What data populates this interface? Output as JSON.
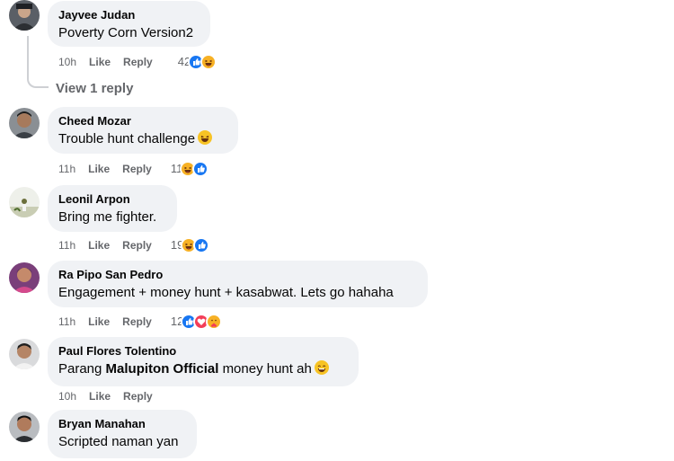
{
  "comments": [
    {
      "author": "Jayvee Judan",
      "text": "Poverty Corn Version2",
      "time": "10h",
      "like": "Like",
      "reply": "Reply",
      "reactions_count": "42",
      "reactions": [
        "like-icon",
        "haha-icon"
      ]
    },
    {
      "author": "Cheed Mozar",
      "text": "Trouble hunt challenge",
      "time": "11h",
      "like": "Like",
      "reply": "Reply",
      "reactions_count": "11",
      "reactions": [
        "haha-icon",
        "like-icon"
      ]
    },
    {
      "author": "Leonil Arpon",
      "text": "Bring me fighter.",
      "time": "11h",
      "like": "Like",
      "reply": "Reply",
      "reactions_count": "19",
      "reactions": [
        "haha-icon",
        "like-icon"
      ]
    },
    {
      "author": "Ra Pipo San Pedro",
      "text": "Engagement + money hunt + kasabwat. Lets go hahaha",
      "time": "11h",
      "like": "Like",
      "reply": "Reply",
      "reactions_count": "12",
      "reactions": [
        "like-icon",
        "love-icon",
        "care-icon"
      ]
    },
    {
      "author": "Paul Flores Tolentino",
      "text_prefix": "Parang",
      "text_mention": "Malupiton Official",
      "text_suffix": "money hunt ah",
      "time": "10h",
      "like": "Like",
      "reply": "Reply"
    },
    {
      "author": "Bryan Manahan",
      "text": "Scripted naman yan"
    }
  ],
  "view_replies": "View 1 reply",
  "colors": {
    "like": "#1877f2",
    "love": "#f33e58",
    "haha": "#f7b125",
    "bubble": "#f0f2f5"
  }
}
